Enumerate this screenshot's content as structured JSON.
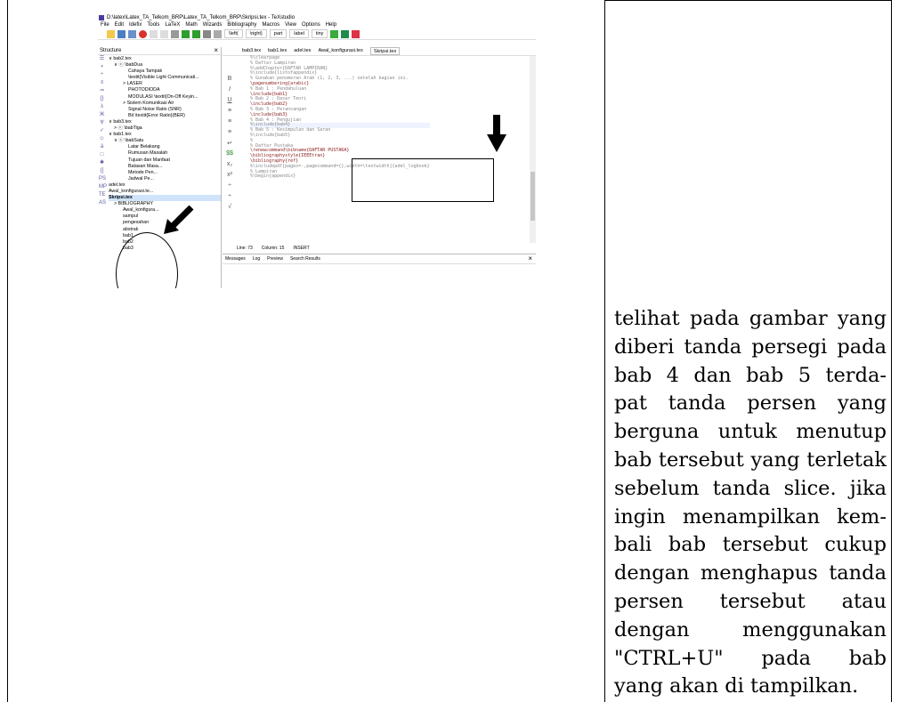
{
  "screenshot": {
    "title": "D:\\latex\\Latex_TA_Telkom_BRP\\Latex_TA_Telkom_BRP\\Skripsi.tex - TeXstudio",
    "menu": [
      "File",
      "Edit",
      "Idefix",
      "Tools",
      "LaTeX",
      "Math",
      "Wizards",
      "Bibliography",
      "Macros",
      "View",
      "Options",
      "Help"
    ],
    "toolbar_selects": [
      "\\left(",
      "\\right)",
      "part",
      "label",
      "tiny"
    ],
    "structure_label": "Structure",
    "tree": [
      "∨ bab2.tex",
      "∨ ⓒ \\babDua",
      "  Cahaya Tampak",
      "  \\textit{Visible Light Communicati...",
      "> LASER",
      "  PHOTODIODA",
      "  MODULASI \\textit{On-Off Keyin...",
      "> Sistem Komunikasi Air",
      "  Signal Noise Ratio (SNR)",
      "  Bit \\textit{Error Ratio}(BER)",
      "∨ bab3.tex",
      "> ⓒ \\babTiga",
      "∨ bab1.tex",
      "∨ ⓒ \\babSatu",
      "  Latar Belakang",
      "  Rumusan Masalah",
      "  Tujuan dan Manfaat",
      "  Batasan Masa...",
      "  Metode Pen...",
      "  Jadwal Pe...",
      "adel.tex",
      "Awal_konfigurasi.te...",
      "Skripsi.tex",
      "> BIBLIOGRAPHY",
      "  Awal_konfigura...",
      "  sampul",
      "  pengesahan",
      "  abstrak",
      "  bab1",
      "  bab2",
      "  bab3"
    ],
    "tabs": [
      "bab3.tex",
      "bab1.tex",
      "adel.tex",
      "Awal_konfigurasi.tex",
      "Skripsi.tex"
    ],
    "code": [
      "%\\clearpage",
      "% Daftar Lampiran",
      "%\\addChapter{DAFTAR LAMPIRAN}",
      "%\\include{listofappendix}",
      "",
      "% Gunakan penomeran Arab (1, 2, 3, ...) setelah bagian ini.",
      "\\pagenumbering{arabic}",
      "% Bab 1 : Pendahuluan",
      "\\include{bab1}",
      "% Bab 2 : Dasar Teori",
      "\\include{bab2}",
      "",
      "% Bab 3 : Perancangan",
      "\\include{bab3}",
      "",
      "% Bab 4 : Pengujian",
      "%\\include{bab4}",
      "",
      "% Bab 5 : Kesimpulan dan Saran",
      "%\\include{bab5}",
      "",
      "%",
      "% Daftar Pustaka",
      "\\renewcommand\\bibname{DAFTAR PUSTAKA}",
      "\\bibliographystyle{IEEEtran}",
      "\\bibliography{ref}",
      "%\\includepdf[pages=-,pagecommand={},width=\\textwidth]{adel_logbook}",
      "",
      "% Lampiran",
      "%\\begin{appendix}"
    ],
    "status": [
      "Line: 73",
      "Column: 15",
      "INSERT"
    ],
    "bottom_tabs": [
      "Messages",
      "Log",
      "Preview",
      "Search Results"
    ]
  },
  "paragraph": [
    "telihat pada gambar yang",
    "diberi tanda persegi pada",
    "bab 4 dan bab 5 terda-",
    "pat tanda persen yang",
    "berguna untuk menutup",
    "bab tersebut yang terletak",
    "sebelum tanda slice. jika",
    "ingin menampilkan kem-",
    "bali bab tersebut cukup",
    "dengan menghapus tanda",
    "persen tersebut atau",
    "dengan menggunakan",
    "\"CTRL+U\" pada bab",
    "yang akan di tampilkan."
  ]
}
